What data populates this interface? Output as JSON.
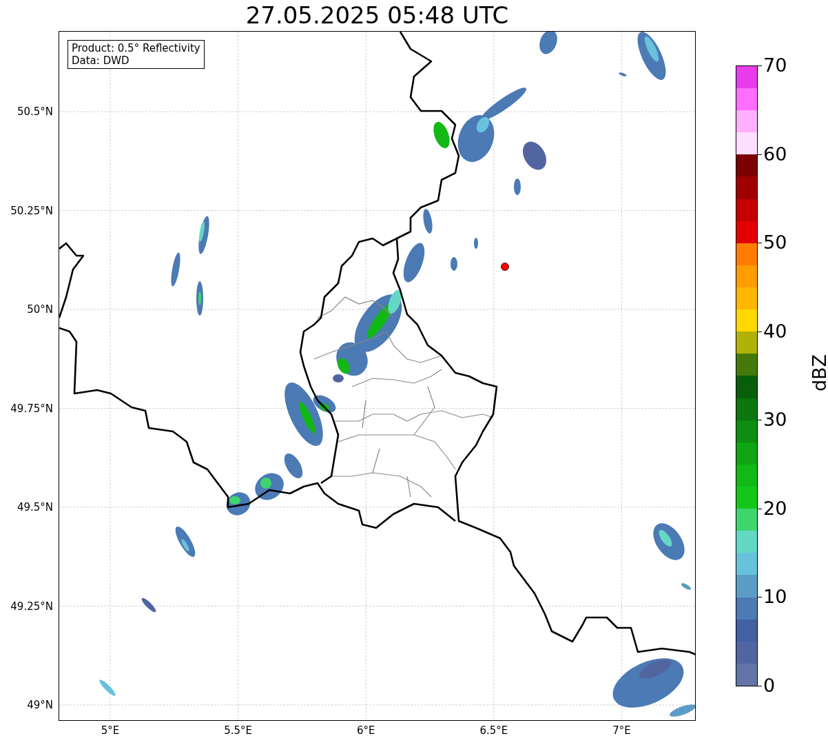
{
  "title": "27.05.2025 05:48 UTC",
  "legend": [
    "Product: 0.5° Reflectivity",
    "Data: DWD"
  ],
  "map": {
    "lat_labels": [
      "50.5°N",
      "50.25°N",
      "50°N",
      "49.75°N",
      "49.5°N",
      "49.25°N",
      "49°N"
    ],
    "lon_labels": [
      "5°E",
      "5.5°E",
      "6°E",
      "6.5°E",
      "7°E"
    ]
  },
  "colorbar": {
    "label": "dBZ",
    "ticks": [
      "70",
      "60",
      "50",
      "40",
      "30",
      "20",
      "10",
      "0"
    ],
    "bins": [
      {
        "color": "#6374a8"
      },
      {
        "color": "#5166a0"
      },
      {
        "color": "#4360a3"
      },
      {
        "color": "#4b7ab5"
      },
      {
        "color": "#5b9cc6"
      },
      {
        "color": "#68c2dc"
      },
      {
        "color": "#63d8c4"
      },
      {
        "color": "#3ed66c"
      },
      {
        "color": "#12c718"
      },
      {
        "color": "#11b816"
      },
      {
        "color": "#0fa413"
      },
      {
        "color": "#0d8e10"
      },
      {
        "color": "#0b770e"
      },
      {
        "color": "#085e0b"
      },
      {
        "color": "#457a0a"
      },
      {
        "color": "#b0b109"
      },
      {
        "color": "#ffd700"
      },
      {
        "color": "#ffb700"
      },
      {
        "color": "#ff9c00"
      },
      {
        "color": "#ff7c00"
      },
      {
        "color": "#e30000"
      },
      {
        "color": "#c40000"
      },
      {
        "color": "#a00000"
      },
      {
        "color": "#7b0000"
      },
      {
        "color": "#ffdfff"
      },
      {
        "color": "#ffb0ff"
      },
      {
        "color": "#ff6eff"
      },
      {
        "color": "#e93ceb"
      }
    ]
  }
}
